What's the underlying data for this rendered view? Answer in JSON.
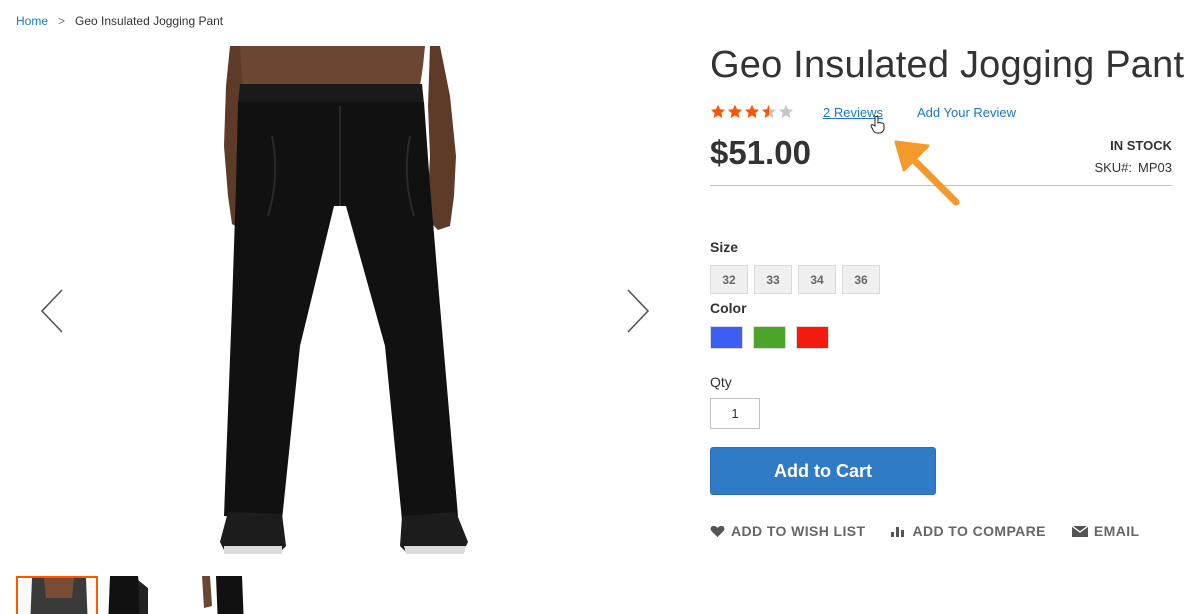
{
  "breadcrumb": {
    "home": "Home",
    "separator": ">",
    "current": "Geo Insulated Jogging Pant"
  },
  "product": {
    "title": "Geo Insulated Jogging Pant",
    "rating": {
      "value": 3.5,
      "max": 5,
      "filled_color": "#ff5501",
      "empty_color": "#c7c7c7"
    },
    "reviews_link": "2  Reviews",
    "add_review_link": "Add Your Review",
    "price": "$51.00",
    "stock": "IN STOCK",
    "sku_label": "SKU#:",
    "sku_value": "MP03"
  },
  "options": {
    "size_label": "Size",
    "sizes": [
      "32",
      "33",
      "34",
      "36"
    ],
    "color_label": "Color",
    "colors": [
      "#3d5ef4",
      "#4ca42a",
      "#f41a10"
    ],
    "qty_label": "Qty",
    "qty_value": "1"
  },
  "buttons": {
    "add_to_cart": "Add to Cart"
  },
  "actions": {
    "wishlist": "ADD TO WISH LIST",
    "compare": "ADD TO COMPARE",
    "email": "EMAIL"
  },
  "colors": {
    "link": "#1979c3",
    "primary_button": "#2f7bc6",
    "annotation_arrow": "#f39a2d",
    "thumb_active_border": "#ff5501"
  },
  "icons": {
    "prev": "chevron-left-icon",
    "next": "chevron-right-icon",
    "wishlist": "heart-icon",
    "compare": "bar-chart-icon",
    "email": "envelope-icon",
    "cursor": "hand-pointer-icon"
  }
}
